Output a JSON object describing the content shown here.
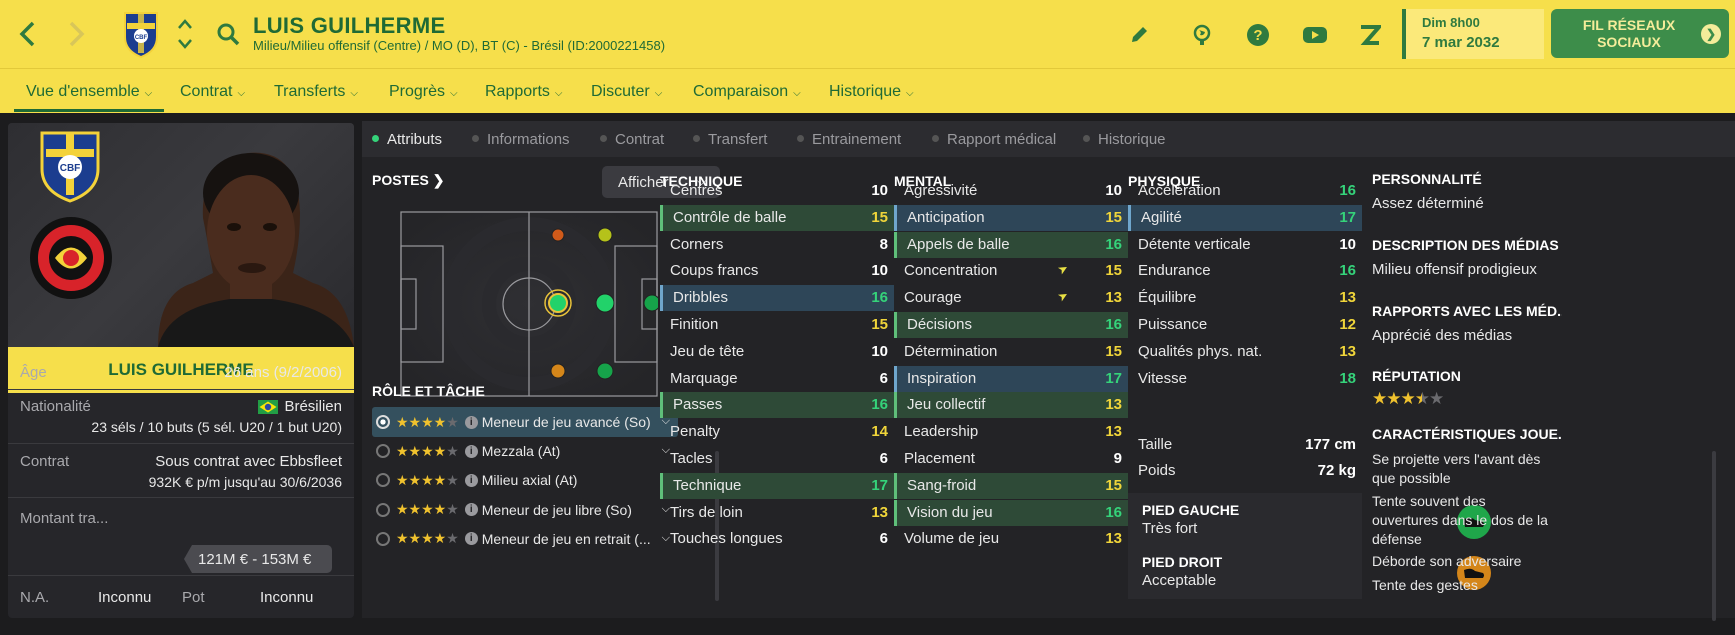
{
  "header": {
    "player_name": "LUIS GUILHERME",
    "player_subtitle": "Milieu/Milieu offensif (Centre) / MO (D), BT (C) - Brésil (ID:2000221458)",
    "date_time": "Dim 8h00",
    "date": "7 mar 2032",
    "social_button": "FIL RÉSEAUX SOCIAUX",
    "icons": [
      "back-icon",
      "forward-icon",
      "cbf-crest-icon",
      "up-down-icon",
      "search-icon",
      "pencil-icon",
      "globe-icon",
      "help-icon",
      "youtube-icon",
      "z-icon"
    ]
  },
  "nav": {
    "items": [
      {
        "label": "Vue d'ensemble"
      },
      {
        "label": "Contrat"
      },
      {
        "label": "Transferts"
      },
      {
        "label": "Progrès"
      },
      {
        "label": "Rapports"
      },
      {
        "label": "Discuter"
      },
      {
        "label": "Comparaison"
      },
      {
        "label": "Historique"
      }
    ]
  },
  "profile": {
    "name": "LUIS GUILHERME",
    "club_name": "EBBSFLEET UNITED FOOTBALL CLUB",
    "national_badge": "CBF",
    "age_label": "Âge",
    "age_value": "26 ans (9/2/2006)",
    "nationality_label": "Nationalité",
    "nationality_value": "Brésilien",
    "caps": "23 séls / 10 buts (5 sél. U20 / 1 but U20)",
    "contract_label": "Contrat",
    "contract_value": "Sous contrat avec Ebbsfleet",
    "contract_detail": "932K € p/m jusqu'au 30/6/2036",
    "value_label": "Montant tra...",
    "value_range": "121M € - 153M €",
    "ca_label": "N.A.",
    "ca_value": "Inconnu",
    "pa_label": "Pot",
    "pa_value": "Inconnu"
  },
  "tabs": [
    {
      "label": "Attributs"
    },
    {
      "label": "Informations"
    },
    {
      "label": "Contrat"
    },
    {
      "label": "Transfert"
    },
    {
      "label": "Entrainement"
    },
    {
      "label": "Rapport médical"
    },
    {
      "label": "Historique"
    }
  ],
  "positions": {
    "title": "POSTES",
    "show_button": "Afficher",
    "role_title": "RÔLE ET TÂCHE",
    "roles": [
      {
        "label": "Meneur de jeu avancé (So)",
        "stars": 4
      },
      {
        "label": "Mezzala (At)",
        "stars": 4
      },
      {
        "label": "Milieu axial (At)",
        "stars": 4
      },
      {
        "label": "Meneur de jeu libre (So)",
        "stars": 4
      },
      {
        "label": "Meneur de jeu en retrait (...",
        "stars": 4
      }
    ],
    "colors": {
      "natural": "#22d26a",
      "accomplished": "#16a34a",
      "competent": "#b5c21a",
      "unconvincing": "#d4861a",
      "awkward": "#d05a1a"
    }
  },
  "technique": {
    "title": "TECHNIQUE",
    "attrs": [
      {
        "name": "Centres",
        "value": "10"
      },
      {
        "name": "Contrôle de balle",
        "value": "15"
      },
      {
        "name": "Corners",
        "value": "8"
      },
      {
        "name": "Coups francs",
        "value": "10"
      },
      {
        "name": "Dribbles",
        "value": "16"
      },
      {
        "name": "Finition",
        "value": "15"
      },
      {
        "name": "Jeu de tête",
        "value": "10"
      },
      {
        "name": "Marquage",
        "value": "6"
      },
      {
        "name": "Passes",
        "value": "16"
      },
      {
        "name": "Penalty",
        "value": "14"
      },
      {
        "name": "Tacles",
        "value": "6"
      },
      {
        "name": "Technique",
        "value": "17"
      },
      {
        "name": "Tirs de loin",
        "value": "13"
      },
      {
        "name": "Touches longues",
        "value": "6"
      }
    ]
  },
  "mental": {
    "title": "MENTAL",
    "attrs": [
      {
        "name": "Agressivité",
        "value": "10"
      },
      {
        "name": "Anticipation",
        "value": "15"
      },
      {
        "name": "Appels de balle",
        "value": "16"
      },
      {
        "name": "Concentration",
        "value": "15"
      },
      {
        "name": "Courage",
        "value": "13"
      },
      {
        "name": "Décisions",
        "value": "16"
      },
      {
        "name": "Détermination",
        "value": "15"
      },
      {
        "name": "Inspiration",
        "value": "17"
      },
      {
        "name": "Jeu collectif",
        "value": "13"
      },
      {
        "name": "Leadership",
        "value": "13"
      },
      {
        "name": "Placement",
        "value": "9"
      },
      {
        "name": "Sang-froid",
        "value": "15"
      },
      {
        "name": "Vision du jeu",
        "value": "16"
      },
      {
        "name": "Volume de jeu",
        "value": "13"
      }
    ]
  },
  "physique": {
    "title": "PHYSIQUE",
    "attrs": [
      {
        "name": "Accélération",
        "value": "16"
      },
      {
        "name": "Agilité",
        "value": "17"
      },
      {
        "name": "Détente verticale",
        "value": "10"
      },
      {
        "name": "Endurance",
        "value": "16"
      },
      {
        "name": "Équilibre",
        "value": "13"
      },
      {
        "name": "Puissance",
        "value": "12"
      },
      {
        "name": "Qualités phys. nat.",
        "value": "13"
      },
      {
        "name": "Vitesse",
        "value": "18"
      }
    ],
    "height_label": "Taille",
    "height_value": "177 cm",
    "weight_label": "Poids",
    "weight_value": "72 kg",
    "left_foot_title": "PIED GAUCHE",
    "left_foot_value": "Très fort",
    "right_foot_title": "PIED DROIT",
    "right_foot_value": "Acceptable"
  },
  "personality": {
    "title": "PERSONNALITÉ",
    "value": "Assez déterminé",
    "media_title": "DESCRIPTION DES MÉDIAS",
    "media_value": "Milieu offensif prodigieux",
    "press_title": "RAPPORTS AVEC LES MÉD...",
    "press_value": "Apprécié des médias",
    "reputation_title": "RÉPUTATION",
    "reputation_stars": 3.5,
    "traits_title": "CARACTÉRISTIQUES JOUE...",
    "traits": [
      "Se projette vers l'avant dès que possible",
      "Tente souvent des ouvertures dans le dos de la défense",
      "Déborde son adversaire",
      "Tente des gestes"
    ]
  }
}
